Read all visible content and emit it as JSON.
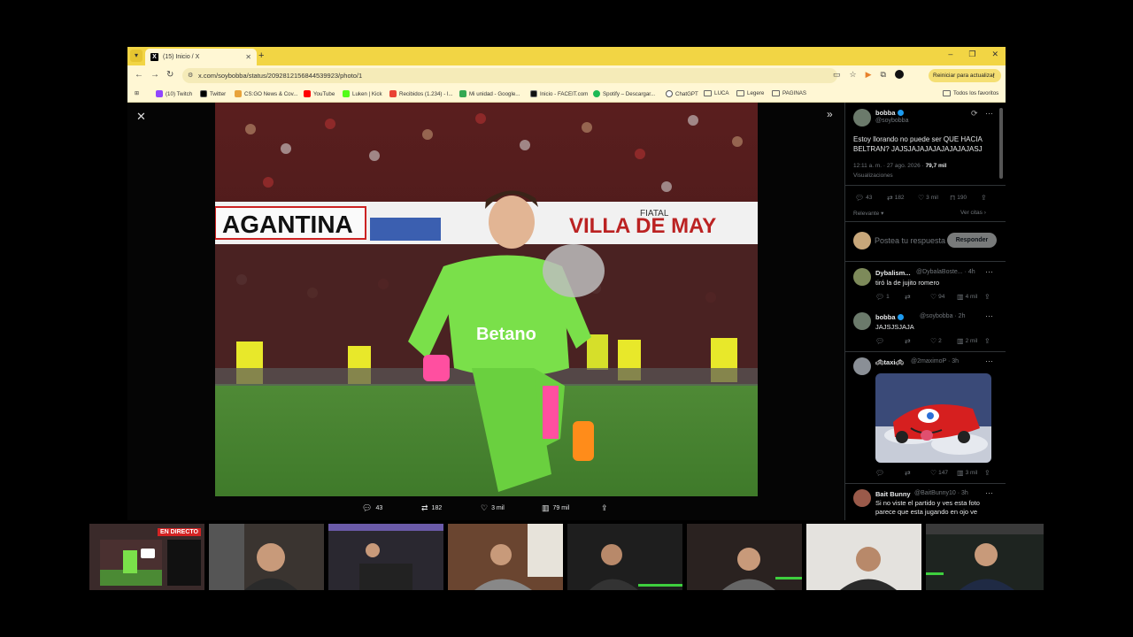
{
  "browser": {
    "tab_title": "(15) Inicio / X",
    "url": "x.com/soybobba/status/2092812156844539923/photo/1",
    "update_label": "Reiniciar para actualizar",
    "bookmarks": [
      {
        "label": "(10) Twitch",
        "color": "#9146ff"
      },
      {
        "label": "Twitter",
        "color": "#000000"
      },
      {
        "label": "CS:GO News & Cov...",
        "color": "#e8a33b"
      },
      {
        "label": "YouTube",
        "color": "#ff0000"
      },
      {
        "label": "Luken | Kick",
        "color": "#53fc18"
      },
      {
        "label": "Recibidos (1.234) - l...",
        "color": "#ea4335"
      },
      {
        "label": "Mi unidad - Google...",
        "color": "#34a853"
      },
      {
        "label": "Inicio - FACEIT.com",
        "color": "#111111"
      },
      {
        "label": "Spotify – Descargar...",
        "color": "#1db954"
      },
      {
        "label": "ChatGPT",
        "color": "#555555"
      },
      {
        "label": "LUCA",
        "color": "folder"
      },
      {
        "label": "Legere",
        "color": "folder"
      },
      {
        "label": "PAGINAS",
        "color": "folder"
      }
    ],
    "all_favorites": "Todos los favoritos"
  },
  "viewer": {
    "actions": {
      "replies": "43",
      "reposts": "182",
      "likes": "3 mil",
      "views": "79 mil"
    },
    "photo_texts": {
      "banner_left": "AGANTINA",
      "banner_right": "VILLA DE MAY",
      "sponsor": "Betano",
      "banner_small": "FIATAL"
    }
  },
  "tweet": {
    "name": "bobba",
    "handle": "@soybobba",
    "text": "Estoy llorando no puede ser QUE HACIA BELTRAN? JAJSJAJAJAJAJAJAJAJASJ",
    "time": "12:11 a. m. · 27 ago. 2026 ·",
    "views_count": "79,7 mil",
    "views_label": "Visualizaciones",
    "stats": {
      "replies": "43",
      "reposts": "182",
      "likes": "3 mil",
      "bookmarks": "190"
    },
    "sort_label": "Relevante",
    "quotes_label": "Ver citas",
    "reply_placeholder": "Postea tu respuesta",
    "reply_button": "Responder"
  },
  "replies": [
    {
      "name": "Dybalism...",
      "handle": "@DybalaBoste... · 4h",
      "text": "tiró la de jujito romero",
      "stats": {
        "replies": "1",
        "reposts": "",
        "likes": "94",
        "views": "4 mil"
      }
    },
    {
      "name": "bobba",
      "handle": "@soybobba · 2h",
      "text": "JAJSJSJAJA",
      "stats": {
        "replies": "",
        "reposts": "",
        "likes": "2",
        "views": "2 mil"
      }
    },
    {
      "name": "taxi",
      "handle": "@2maximoP · 3h",
      "text": "",
      "stats": {
        "replies": "",
        "reposts": "",
        "likes": "147",
        "views": "3 mil"
      }
    },
    {
      "name": "Bait Bunny",
      "handle": "@BaitBunny10 · 3h",
      "text": "Si no viste el partido y ves esta foto parece que esta jugando en ojo ve",
      "stats": {}
    }
  ],
  "stream": {
    "live_badge": "EN DIRECTO"
  },
  "colors": {
    "chrome_yellow": "#f2d544",
    "x_blue": "#1d9bf0",
    "kit_green": "#7ae04a",
    "live_red": "#d42323"
  }
}
